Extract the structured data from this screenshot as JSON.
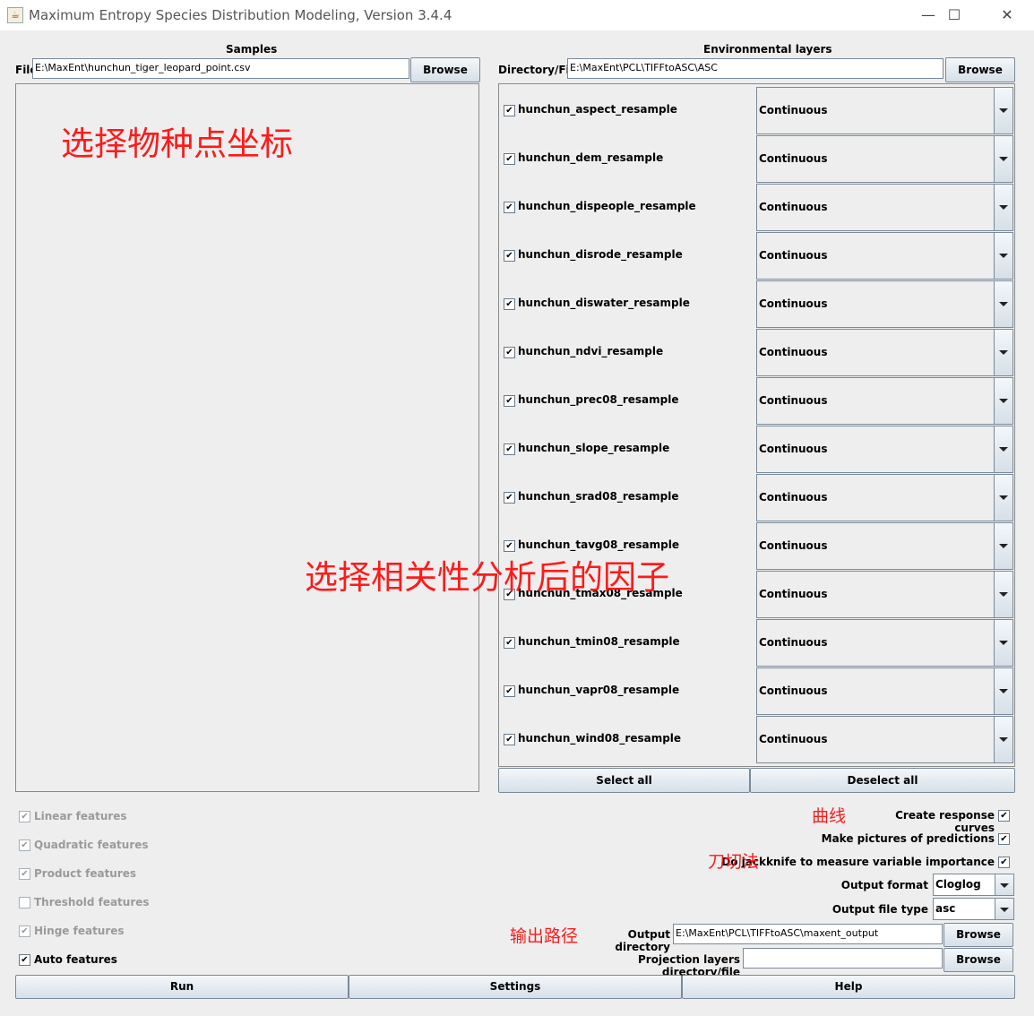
{
  "window": {
    "title": "Maximum Entropy Species Distribution Modeling, Version 3.4.4",
    "minimize": "—",
    "maximize": "☐",
    "close": "✕"
  },
  "samples": {
    "heading": "Samples",
    "file_label": "File",
    "file_value": "E:\\MaxEnt\\hunchun_tiger_leopard_point.csv",
    "browse": "Browse"
  },
  "env": {
    "heading": "Environmental layers",
    "dir_label": "Directory/File",
    "dir_value": "E:\\MaxEnt\\PCL\\TIFFtoASC\\ASC",
    "browse": "Browse",
    "layers": [
      {
        "name": "hunchun_aspect_resample",
        "type": "Continuous",
        "checked": true
      },
      {
        "name": "hunchun_dem_resample",
        "type": "Continuous",
        "checked": true
      },
      {
        "name": "hunchun_dispeople_resample",
        "type": "Continuous",
        "checked": true
      },
      {
        "name": "hunchun_disrode_resample",
        "type": "Continuous",
        "checked": true
      },
      {
        "name": "hunchun_diswater_resample",
        "type": "Continuous",
        "checked": true
      },
      {
        "name": "hunchun_ndvi_resample",
        "type": "Continuous",
        "checked": true
      },
      {
        "name": "hunchun_prec08_resample",
        "type": "Continuous",
        "checked": true
      },
      {
        "name": "hunchun_slope_resample",
        "type": "Continuous",
        "checked": true
      },
      {
        "name": "hunchun_srad08_resample",
        "type": "Continuous",
        "checked": true
      },
      {
        "name": "hunchun_tavg08_resample",
        "type": "Continuous",
        "checked": true
      },
      {
        "name": "hunchun_tmax08_resample",
        "type": "Continuous",
        "checked": true
      },
      {
        "name": "hunchun_tmin08_resample",
        "type": "Continuous",
        "checked": true
      },
      {
        "name": "hunchun_vapr08_resample",
        "type": "Continuous",
        "checked": true
      },
      {
        "name": "hunchun_wind08_resample",
        "type": "Continuous",
        "checked": true
      }
    ],
    "select_all": "Select all",
    "deselect_all": "Deselect all"
  },
  "features": [
    {
      "label": "Linear features",
      "checked": true,
      "enabled": false
    },
    {
      "label": "Quadratic features",
      "checked": true,
      "enabled": false
    },
    {
      "label": "Product features",
      "checked": true,
      "enabled": false
    },
    {
      "label": "Threshold features",
      "checked": false,
      "enabled": false
    },
    {
      "label": "Hinge features",
      "checked": true,
      "enabled": false
    },
    {
      "label": "Auto features",
      "checked": true,
      "enabled": true
    }
  ],
  "options": {
    "response_curves": "Create response curves",
    "pictures": "Make pictures of predictions",
    "jackknife": "Do jackknife to measure variable importance",
    "output_format_label": "Output format",
    "output_format_value": "Cloglog",
    "output_file_type_label": "Output file type",
    "output_file_type_value": "asc",
    "output_dir_label": "Output directory",
    "output_dir_value": "E:\\MaxEnt\\PCL\\TIFFtoASC\\maxent_output",
    "projection_label": "Projection layers directory/file",
    "projection_value": "",
    "browse": "Browse"
  },
  "bottom": {
    "run": "Run",
    "settings": "Settings",
    "help": "Help"
  },
  "annotations": {
    "select_points": "选择物种点坐标",
    "select_factors": "选择相关性分析后的因子",
    "curves": "曲线",
    "jackknife": "刀切法",
    "output_path": "输出路径"
  },
  "colors": {
    "annotation": "#ff1a1a",
    "background": "#eeeeee"
  }
}
